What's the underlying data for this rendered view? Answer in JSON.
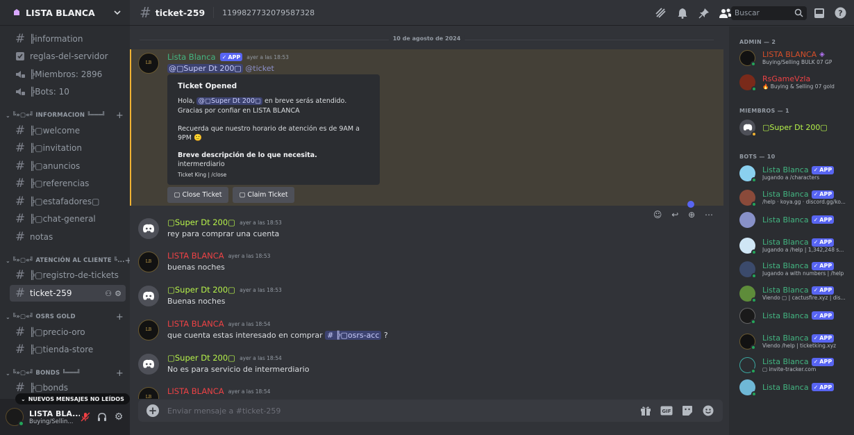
{
  "server": {
    "name": "LISTA BLANCA"
  },
  "sidebar": {
    "channels": [
      {
        "label": "╠information",
        "type": "text"
      },
      {
        "label": "reglas-del-servidor",
        "type": "rules"
      },
      {
        "label": "╠Miembros: 2896",
        "type": "voice"
      },
      {
        "label": "╠Bots: 10",
        "type": "voice"
      }
    ],
    "cat_info": "╚»▢«╝ INFORMACION ╚═══╝",
    "info_channels": [
      "╠▢welcome",
      "╠▢invitation",
      "╠▢anuncios",
      "╠▢referencias",
      "╠▢estafadores▢",
      "╠▢chat-general",
      "notas"
    ],
    "cat_atencion": "╚»▢«╝ ATENCIÓN AL CLIENTE ╚...",
    "atencion_channels": [
      "╠▢registro-de-tickets",
      "ticket-259"
    ],
    "cat_osrs": "╚»▢«╝ OSRS GOLD",
    "osrs_channels": [
      "╠▢precio-oro",
      "╠▢tienda-store"
    ],
    "cat_bonds": "╚»▢«╝ BONDS ╚═══╝",
    "bonds_channels": [
      "╠▢bonds"
    ],
    "unread": "NUEVOS MENSAJES NO LEÍDOS"
  },
  "user": {
    "name": "LISTA BLA...",
    "status": "Buying/Sellin..."
  },
  "topbar": {
    "channel": "ticket-259",
    "topic": "1199827732079587328",
    "search": "Buscar"
  },
  "chat": {
    "date": "10 de agosto de 2024",
    "msg1": {
      "author": "Lista Blanca",
      "badge": "APP",
      "time": "ayer a las 18:53",
      "mention": "@▢Super Dt 200▢",
      "mention2": "@ticket"
    },
    "embed": {
      "title": "Ticket Opened",
      "hola": "Hola,",
      "mention": "@▢Super Dt 200▢",
      "line1rest": "en breve serás atendido.",
      "line2": "Gracias por confiar en LISTA BLANCA",
      "line3": "Recuerda que nuestro horario de atención es de 9AM a 9PM 🙂",
      "bold": "Breve descripción de lo que necesita.",
      "desc": "intermerdiario",
      "footer": "Ticket King | /close"
    },
    "btn_close": "▢ Close Ticket",
    "btn_claim": "▢ Claim Ticket",
    "messages": [
      {
        "author": "▢Super Dt 200▢",
        "color": "lime",
        "time": "ayer a las 18:53",
        "text": "rey para comprar una cuenta",
        "av": "discord"
      },
      {
        "author": "LISTA BLANCA",
        "color": "red",
        "time": "ayer a las 18:53",
        "text": "buenas noches",
        "av": "lb"
      },
      {
        "author": "▢Super Dt 200▢",
        "color": "lime",
        "time": "ayer a las 18:53",
        "text": "Buenas noches",
        "av": "discord"
      },
      {
        "author": "LISTA BLANCA",
        "color": "red",
        "time": "ayer a las 18:54",
        "text": "que cuenta estas interesado en comprar",
        "link": "# ╠▢osrs-acc",
        "after": "?",
        "av": "lb"
      },
      {
        "author": "▢Super Dt 200▢",
        "color": "lime",
        "time": "ayer a las 18:54",
        "text": "No es para servicio de intermerdiario",
        "av": "discord"
      },
      {
        "author": "LISTA BLANCA",
        "color": "red",
        "time": "ayer a las 18:54",
        "text": "",
        "av": "lb"
      }
    ],
    "placeholder": "Enviar mensaje a #ticket-259"
  },
  "members": {
    "admin_header": "ADMIN — 2",
    "admins": [
      {
        "name": "LISTA BLANCA",
        "status": "Buying/Selling BULK 07 GP"
      },
      {
        "name": "RsGameVzla",
        "status": "🔥 Buying & Selling 07 gold"
      }
    ],
    "miembros_header": "MIEMBROS — 1",
    "miembros": [
      {
        "name": "▢Super Dt 200▢"
      }
    ],
    "bots_header": "BOTS — 10",
    "bots": [
      {
        "name": "Lista Blanca",
        "badge": "APP",
        "status": "Jugando a /characters"
      },
      {
        "name": "Lista Blanca",
        "badge": "APP",
        "status": "/help · koya.gg · discord.gg/ko..."
      },
      {
        "name": "Lista Blanca",
        "badge": "APP",
        "status": ""
      },
      {
        "name": "Lista Blanca",
        "badge": "APP",
        "status": "Jugando a /help | 1,342,248 s..."
      },
      {
        "name": "Lista Blanca",
        "badge": "APP",
        "status": "Jugando a with numbers | /help"
      },
      {
        "name": "Lista Blanca",
        "badge": "APP",
        "status": "Viendo ▢ | cactusfire.xyz | dis..."
      },
      {
        "name": "Lista Blanca",
        "badge": "APP",
        "status": ""
      },
      {
        "name": "Lista Blanca",
        "badge": "APP",
        "status": "Viendo /help | ticketking.xyz"
      },
      {
        "name": "Lista Blanca",
        "badge": "APP",
        "status": "▢ invite-tracker.com"
      },
      {
        "name": "Lista Blanca",
        "badge": "APP",
        "status": ""
      }
    ]
  }
}
